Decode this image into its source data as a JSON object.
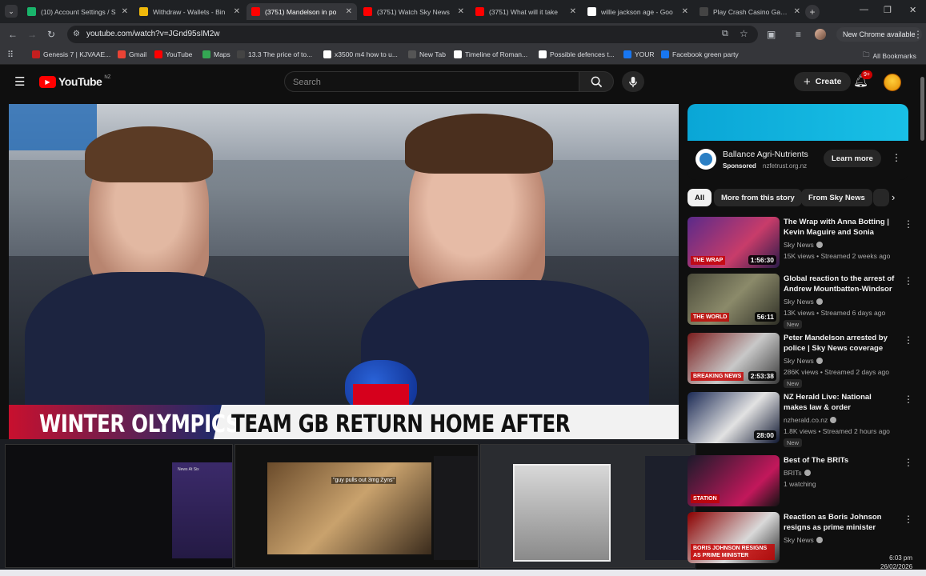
{
  "browser": {
    "tabs": [
      {
        "title": "(10) Account Settings / S",
        "fav_color": "#19b46b"
      },
      {
        "title": "Withdraw - Wallets - Bin",
        "fav_color": "#f0b90b"
      },
      {
        "title": "(3751) Mandelson in po",
        "fav_color": "#ff0000"
      },
      {
        "title": "(3751) Watch Sky News",
        "fav_color": "#ff0000"
      },
      {
        "title": "(3751) What will it take",
        "fav_color": "#ff0000"
      },
      {
        "title": "willie jackson age - Goo",
        "fav_color": "#ffffff"
      },
      {
        "title": "Play Crash Casino Game",
        "fav_color": "#444444"
      }
    ],
    "url": "youtube.com/watch?v=JGnd95sIM2w",
    "new_chrome_label": "New Chrome available",
    "bookmarks": [
      "Genesis 7 | KJVAAE...",
      "Gmail",
      "YouTube",
      "Maps",
      "13.3 The price of to...",
      "x3500 m4 how to u...",
      "New Tab",
      "Timeline of Roman...",
      "Possible defences t...",
      "YOUR",
      "Facebook green party"
    ],
    "all_bookmarks_label": "All Bookmarks"
  },
  "youtube": {
    "logo_text": "YouTube",
    "region": "NZ",
    "search_placeholder": "Search",
    "create_label": "Create",
    "notif_count": "9+"
  },
  "video": {
    "lower_third_left": "WINTER OLYMPICS",
    "lower_third_right": "TEAM GB RETURN HOME AFTER GAMES"
  },
  "ad": {
    "advertiser": "Ballance Agri-Nutrients",
    "sponsored_label": "Sponsored",
    "domain": "nzfetrust.org.nz",
    "cta": "Learn more"
  },
  "chips": [
    "All",
    "More from this story",
    "From Sky News"
  ],
  "recommendations": [
    {
      "title": "The Wrap with Anna Botting | Kevin Maguire and Sonia Sodh...",
      "channel": "Sky News",
      "meta": "15K views • Streamed 2 weeks ago",
      "duration": "1:56:30",
      "badge": "",
      "thumb_label": "THE WRAP"
    },
    {
      "title": "Global reaction to the arrest of Andrew Mountbatten-Windsor ...",
      "channel": "Sky News",
      "meta": "13K views • Streamed 6 days ago",
      "duration": "56:11",
      "badge": "New",
      "thumb_label": "THE WORLD"
    },
    {
      "title": "Peter Mandelson arrested by police | Sky News coverage",
      "channel": "Sky News",
      "meta": "286K views • Streamed 2 days ago",
      "duration": "2:53:38",
      "badge": "New",
      "thumb_label": "BREAKING NEWS"
    },
    {
      "title": "NZ Herald Live: National makes law & order announcement",
      "channel": "nzherald.co.nz",
      "meta": "1.8K views • Streamed 2 hours ago",
      "duration": "28:00",
      "badge": "New",
      "thumb_label": ""
    },
    {
      "title": "Best of The BRITs",
      "channel": "BRITs",
      "meta": "1 watching",
      "duration": "",
      "badge": "",
      "thumb_label": "STATION"
    },
    {
      "title": "Reaction as Boris Johnson resigns as prime minister",
      "channel": "Sky News",
      "meta": "",
      "duration": "",
      "badge": "",
      "thumb_label": "BORIS JOHNSON RESIGNS AS PRIME MINISTER"
    }
  ],
  "previews": [
    {
      "label": "News At Six"
    },
    {
      "label": "\"guy pulls out 3mg Zyns\""
    },
    {
      "label": ""
    }
  ],
  "clock": {
    "time": "6:03 pm",
    "date": "26/02/2026"
  }
}
